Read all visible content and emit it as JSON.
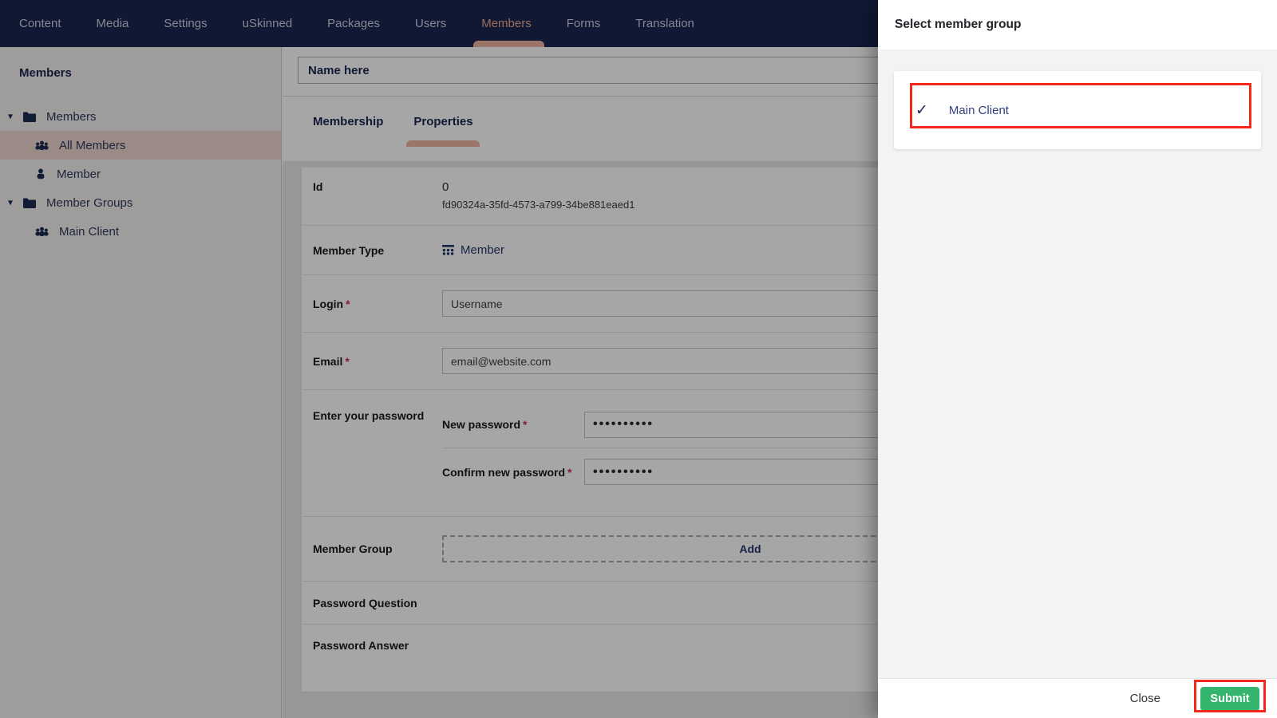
{
  "nav": {
    "items": [
      {
        "label": "Content",
        "active": false
      },
      {
        "label": "Media",
        "active": false
      },
      {
        "label": "Settings",
        "active": false
      },
      {
        "label": "uSkinned",
        "active": false
      },
      {
        "label": "Packages",
        "active": false
      },
      {
        "label": "Users",
        "active": false
      },
      {
        "label": "Members",
        "active": true
      },
      {
        "label": "Forms",
        "active": false
      },
      {
        "label": "Translation",
        "active": false
      }
    ]
  },
  "sidebar": {
    "title": "Members",
    "tree": [
      {
        "label": "Members",
        "type": "folder",
        "expanded": true,
        "selected": false
      },
      {
        "label": "All Members",
        "type": "member-group",
        "selected": true
      },
      {
        "label": "Member",
        "type": "member",
        "selected": false
      },
      {
        "label": "Member Groups",
        "type": "folder",
        "expanded": true,
        "selected": false
      },
      {
        "label": "Main Client",
        "type": "member-group",
        "selected": false
      }
    ]
  },
  "editor": {
    "name_value": "Name here",
    "tabs": [
      {
        "label": "Membership",
        "active": false
      },
      {
        "label": "Properties",
        "active": true
      }
    ],
    "fields": {
      "id_label": "Id",
      "id_value": "0",
      "id_guid": "fd90324a-35fd-4573-a799-34be881eaed1",
      "member_type_label": "Member Type",
      "member_type_value": "Member",
      "login_label": "Login",
      "login_value": "Username",
      "email_label": "Email",
      "email_value": "email@website.com",
      "password_section_label": "Enter your password",
      "new_password_label": "New password",
      "new_password_value": "••••••••••",
      "confirm_password_label": "Confirm new password",
      "confirm_password_value": "••••••••••",
      "member_group_label": "Member Group",
      "add_button_label": "Add",
      "password_question_label": "Password Question",
      "password_answer_label": "Password Answer"
    }
  },
  "panel": {
    "title": "Select member group",
    "option_label": "Main Client",
    "close_label": "Close",
    "submit_label": "Submit"
  },
  "icons": {
    "caret": "▾",
    "check": "✓",
    "required": "*"
  },
  "colors": {
    "navbar_navy": "#1b264f",
    "accent_salmon": "#eeb3a4",
    "active_nav_text": "#f0ab8e",
    "selected_tree_row": "#eed6cf",
    "submit_green": "#34b56d",
    "annotation_red": "#f3291b",
    "required_red": "#cc2d50",
    "option_text_navy": "#33427d"
  }
}
